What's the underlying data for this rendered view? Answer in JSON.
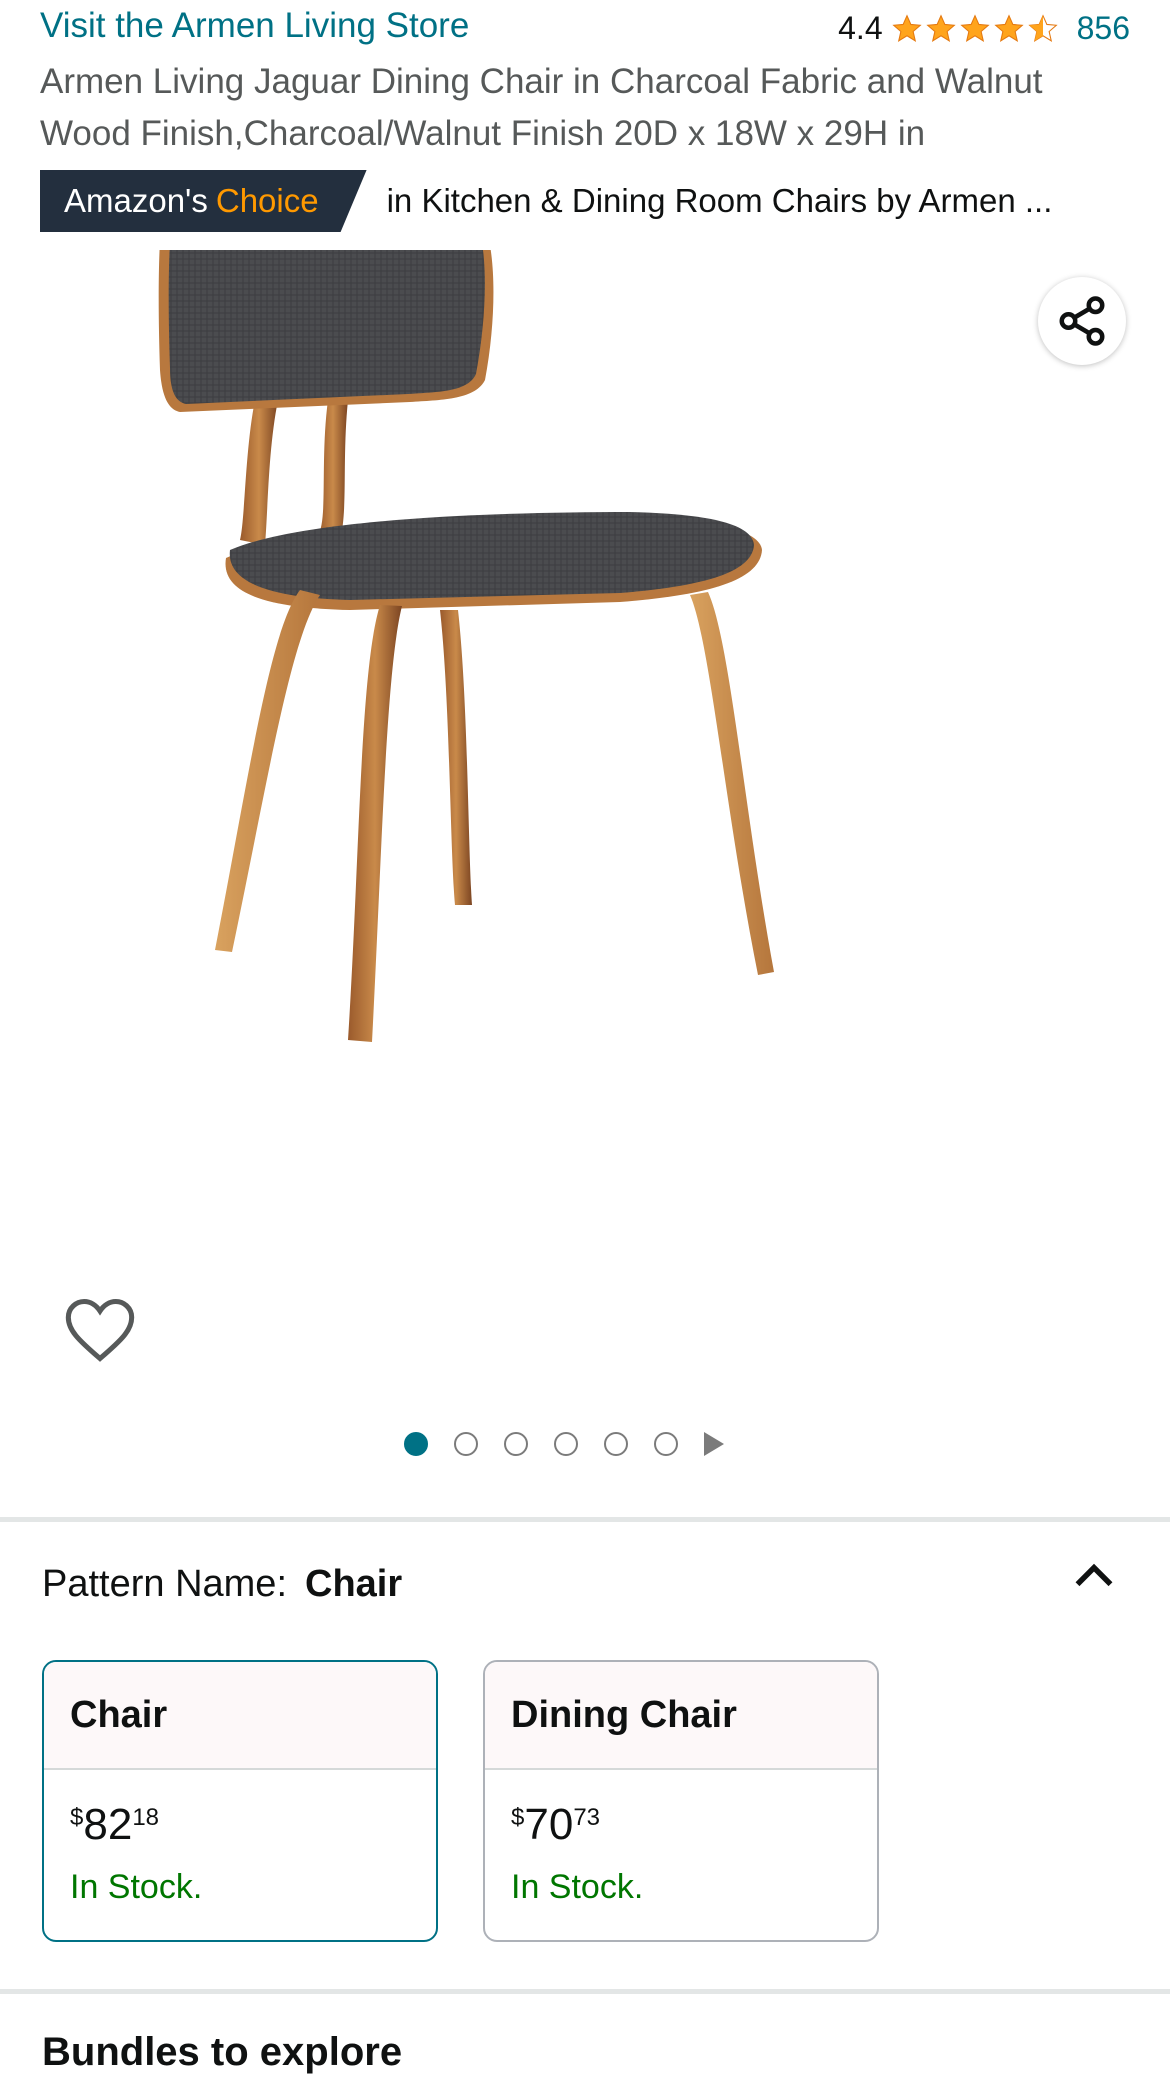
{
  "header": {
    "store_link": "Visit the Armen Living Store",
    "rating": "4.4",
    "stars": 4.5,
    "review_count": "856",
    "title": "Armen Living Jaguar Dining Chair in Charcoal Fabric and Walnut Wood Finish,Charcoal/Walnut Finish 20D x 18W x 29H in"
  },
  "badge": {
    "prefix": "Amazon's",
    "choice": "Choice",
    "category_text": "in Kitchen & Dining Room Chairs by Armen ..."
  },
  "gallery": {
    "image_count": 6,
    "active_index": 0
  },
  "pattern": {
    "label": "Pattern Name:",
    "value": "Chair"
  },
  "options": [
    {
      "name": "Chair",
      "price_symbol": "$",
      "price_whole": "82",
      "price_fraction": "18",
      "stock": "In Stock."
    },
    {
      "name": "Dining Chair",
      "price_symbol": "$",
      "price_whole": "70",
      "price_fraction": "73",
      "stock": "In Stock."
    }
  ],
  "section": {
    "bundles_title": "Bundles to explore"
  },
  "colors": {
    "link": "#007185",
    "badge_bg": "#232f3e",
    "badge_accent": "#ff9900",
    "star": "#ffa41c",
    "in_stock": "#007600"
  }
}
